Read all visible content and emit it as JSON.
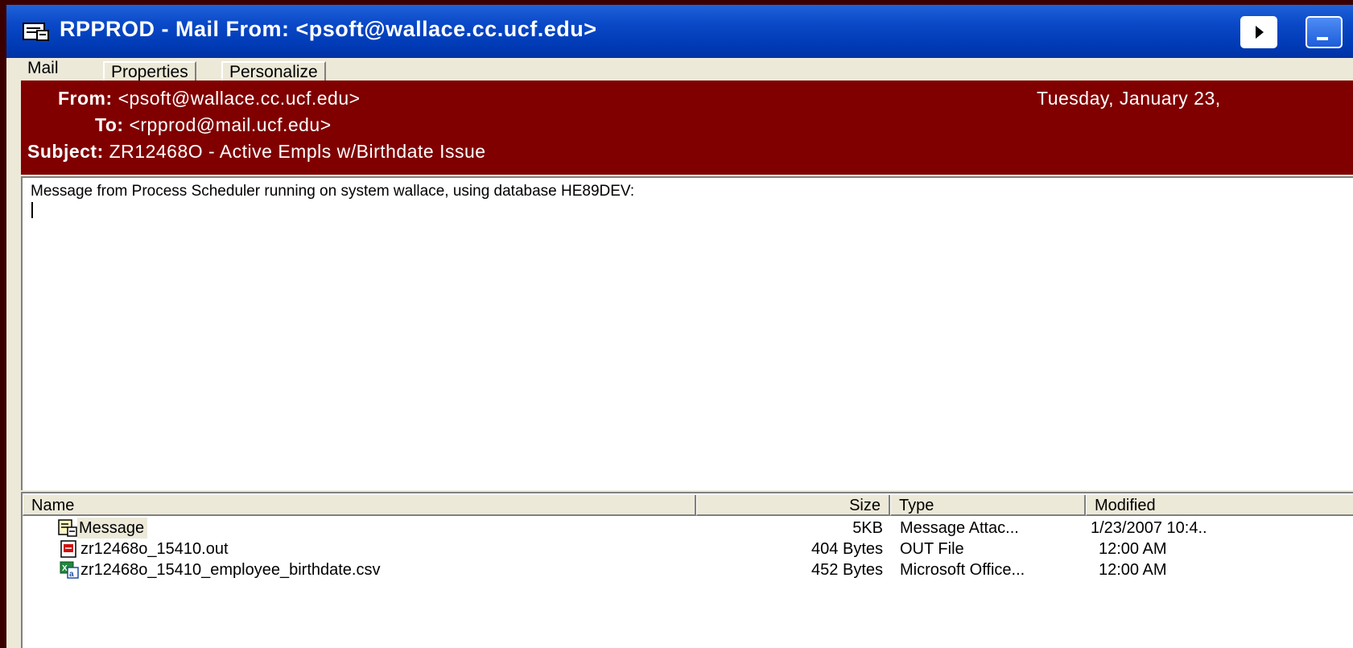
{
  "window": {
    "title": "RPPROD - Mail From: <psoft@wallace.cc.ucf.edu>",
    "icon": "mail-window-icon",
    "buttons": [
      "play-icon",
      "minimize-icon"
    ]
  },
  "tabs": [
    {
      "label": "Mail"
    },
    {
      "label": "Properties"
    },
    {
      "label": "Personalize"
    }
  ],
  "header": {
    "from_label": "From:",
    "from_value": "<psoft@wallace.cc.ucf.edu>",
    "to_label": "To:",
    "to_value": "<rpprod@mail.ucf.edu>",
    "subject_label": "Subject:",
    "subject_value": "ZR12468O - Active Empls w/Birthdate Issue",
    "date": "Tuesday, January 23,"
  },
  "body": {
    "text": "Message from Process Scheduler running on system wallace, using database HE89DEV:"
  },
  "attachments": {
    "columns": [
      "Name",
      "Size",
      "Type",
      "Modified"
    ],
    "rows": [
      {
        "icon": "message-attachment-icon",
        "name": "Message",
        "size": "5KB",
        "type": "Message Attac...",
        "modified": "1/23/2007 10:4.."
      },
      {
        "icon": "out-file-icon",
        "name": "zr12468o_15410.out",
        "size": "404 Bytes",
        "type": "OUT File",
        "modified": "12:00 AM"
      },
      {
        "icon": "excel-csv-icon",
        "name": "zr12468o_15410_employee_birthdate.csv",
        "size": "452 Bytes",
        "type": "Microsoft Office...",
        "modified": "12:00 AM"
      }
    ]
  },
  "colors": {
    "header_bg": "#800000",
    "titlebar": "#0039b3",
    "outer_bg": "#3a0000"
  }
}
